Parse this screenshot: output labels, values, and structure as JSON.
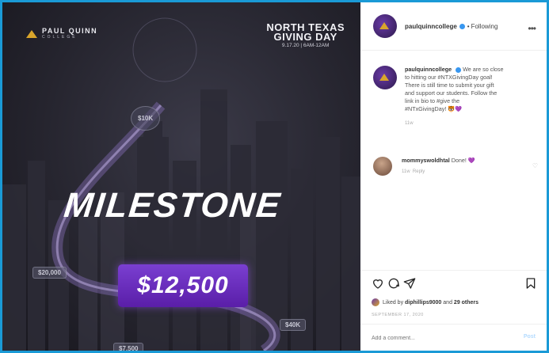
{
  "image": {
    "brand_name": "PAUL QUINN",
    "brand_sub": "COLLEGE",
    "event_line1": "NORTH TEXAS",
    "event_line2": "GIVING DAY",
    "event_date": "9.17.20 | 6AM-12AM",
    "headline": "MILESTONE",
    "total": "$12,500",
    "tags": [
      "$10K",
      "$20,000",
      "$40K",
      "$7,500"
    ]
  },
  "post": {
    "username": "paulquinncollege",
    "separator": "•",
    "follow_status": "Following",
    "more_icon": "more-horizontal-icon",
    "caption_lines": [
      "We are so close",
      "to hitting our #NTXGivingDay goal!",
      "There is still time to submit your gift",
      "and support our students. Follow the",
      "link in bio to #give the",
      "#NTxGivingDay! 🐯💜"
    ],
    "caption_time": "11w",
    "comment": {
      "username": "mommyswoldhtal",
      "text": "Done! 💜",
      "time": "11w",
      "reply": "Reply"
    },
    "likes_prefix": "Liked by",
    "likes_user": "diphillips9000",
    "likes_suffix": "and",
    "likes_others": "29 others",
    "date": "SEPTEMBER 17, 2020",
    "comment_placeholder": "Add a comment...",
    "post_button": "Post",
    "colors": {
      "accent": "#7a3fd1",
      "link": "#3897f0",
      "frame": "#1a9ad6",
      "gold": "#d9a52b"
    }
  }
}
